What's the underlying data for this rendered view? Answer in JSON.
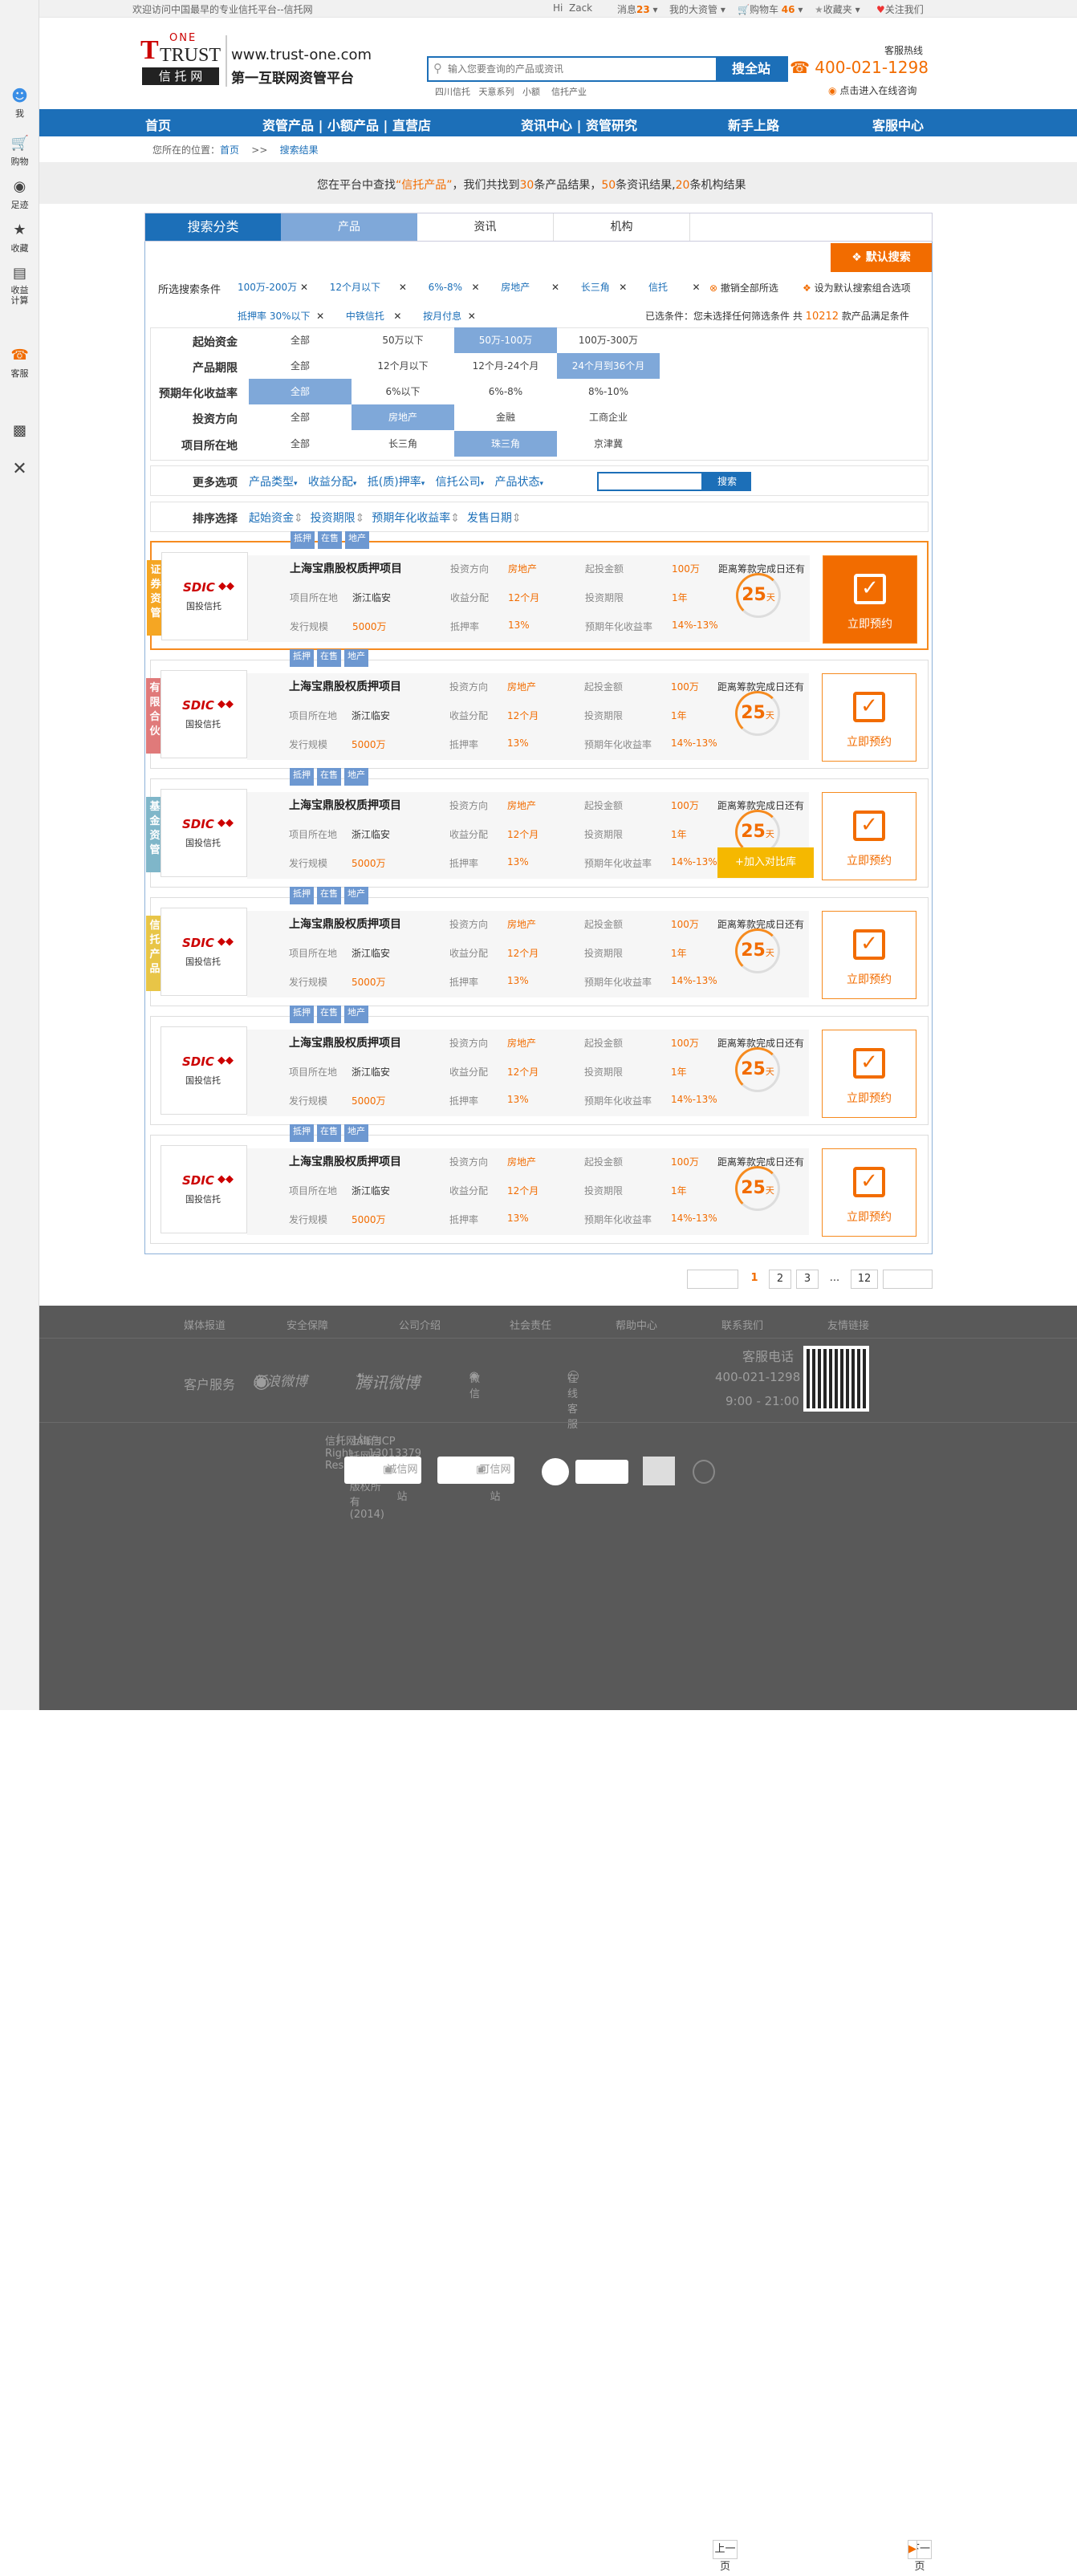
{
  "topbar": {
    "welcome": "欢迎访问中国最早的专业信托平台--信托网",
    "hi": "Hi",
    "user": "Zack",
    "messages": "消息",
    "messages_count": "23",
    "my_assets": "我的大资管",
    "cart": "购物车",
    "cart_count": "46",
    "favorites": "收藏夹",
    "follow": "关注我们"
  },
  "sidebar": {
    "items": [
      {
        "icon": "user-icon",
        "label": "我"
      },
      {
        "icon": "cart-icon",
        "label": "购物"
      },
      {
        "icon": "footprint-icon",
        "label": "足迹"
      },
      {
        "icon": "star-icon",
        "label": "收藏"
      },
      {
        "icon": "calculator-icon",
        "label": "收益计算"
      },
      {
        "icon": "service-icon",
        "label": "客服"
      },
      {
        "icon": "qrcode-icon",
        "label": ""
      },
      {
        "icon": "close-icon",
        "label": ""
      }
    ]
  },
  "header": {
    "logo_one": "ONE",
    "logo_trust": "TRUST",
    "logo_cn": "信 托 网",
    "domain": "www.trust-one.com",
    "slogan": "第一互联网资管平台",
    "search_placeholder": "输入您要查询的产品或资讯",
    "search_button": "搜全站",
    "hot_words": [
      "四川信托",
      "天意系列",
      "小额",
      "信托产业"
    ],
    "hotline_label": "客服热线",
    "hotline": "400-021-1298",
    "online": "点击进入在线咨询"
  },
  "nav": {
    "items": [
      "首页",
      "资管产品 | 小额产品 | 直营店",
      "资讯中心 | 资管研究",
      "新手上路",
      "客服中心"
    ]
  },
  "crumb": {
    "label": "您所在的位置：",
    "home": "首页",
    "sep": ">>",
    "current": "搜索结果"
  },
  "banner": {
    "prefix": "您在平台中查找",
    "keyword": "“信托产品”",
    "mid": "，我们共找到",
    "n1": "30",
    "t1": "条产品结果，",
    "n2": "50",
    "t2": "条资讯结果,",
    "n3": "20",
    "t3": "条机构结果"
  },
  "tabs": {
    "title": "搜索分类",
    "items": [
      "产品",
      "资讯",
      "机构"
    ]
  },
  "default_search": "默认搜索",
  "conditions": {
    "label": "所选搜索条件",
    "tags": [
      "100万-200万",
      "12个月以下",
      "6%-8%",
      "房地产",
      "长三角",
      "信托",
      "抵押率 30%以下",
      "中铁信托",
      "按月付息"
    ],
    "cancel_all": "撤销全部所选",
    "set_default": "设为默认搜索组合选项",
    "summary_prefix": "已选条件：",
    "summary_text": "您未选择任何筛选条件 共",
    "summary_count": "10212",
    "summary_suffix": "款产品满足条件"
  },
  "filters": [
    {
      "label": "起始资金",
      "options": [
        "全部",
        "50万以下",
        "50万-100万",
        "100万-300万"
      ],
      "selected": 2
    },
    {
      "label": "产品期限",
      "options": [
        "全部",
        "12个月以下",
        "12个月-24个月",
        "24个月到36个月"
      ],
      "selected": 3
    },
    {
      "label": "预期年化收益率",
      "options": [
        "全部",
        "6%以下",
        "6%-8%",
        "8%-10%"
      ],
      "selected": 0
    },
    {
      "label": "投资方向",
      "options": [
        "全部",
        "房地产",
        "金融",
        "工商企业"
      ],
      "selected": 1
    },
    {
      "label": "项目所在地",
      "options": [
        "全部",
        "长三角",
        "珠三角",
        "京津冀"
      ],
      "selected": 2
    }
  ],
  "more": {
    "label": "更多选项",
    "items": [
      "产品类型",
      "收益分配",
      "抵(质)押率",
      "信托公司",
      "产品状态"
    ],
    "search_button": "搜索"
  },
  "sort": {
    "label": "排序选择",
    "items": [
      "起始资金",
      "投资期限",
      "预期年化收益率",
      "发售日期"
    ]
  },
  "card_labels": {
    "direction": "投资方向",
    "min_amount": "起投金额",
    "countdown": "距离筹款完成日还有",
    "location": "项目所在地",
    "distribution": "收益分配",
    "period": "投资期限",
    "scale": "发行规模",
    "pledge": "抵押率",
    "yield": "预期年化收益率",
    "days_unit": "天",
    "book": "立即预约",
    "compare": "+加入对比库"
  },
  "products": [
    {
      "tag": "证券资管",
      "tag_color": "#f5a623",
      "ribbons": [
        "抵押",
        "在售",
        "地产"
      ],
      "company": "国投信托",
      "logo": "SDIC",
      "name": "上海宝鼎股权质押项目",
      "direction": "房地产",
      "min_amount": "100万",
      "location": "浙江临安",
      "distribution": "12个月",
      "period": "1年",
      "scale": "5000万",
      "pledge": "13%",
      "yield": "14%-13%",
      "days": "25"
    },
    {
      "tag": "有限合伙",
      "tag_color": "#e07a7a",
      "ribbons": [
        "抵押",
        "在售",
        "地产"
      ],
      "company": "国投信托",
      "logo": "SDIC",
      "name": "上海宝鼎股权质押项目",
      "direction": "房地产",
      "min_amount": "100万",
      "location": "浙江临安",
      "distribution": "12个月",
      "period": "1年",
      "scale": "5000万",
      "pledge": "13%",
      "yield": "14%-13%",
      "days": "25"
    },
    {
      "tag": "基金资管",
      "tag_color": "#7fb6c9",
      "ribbons": [
        "抵押",
        "在售",
        "地产"
      ],
      "company": "国投信托",
      "logo": "SDIC",
      "name": "上海宝鼎股权质押项目",
      "direction": "房地产",
      "min_amount": "100万",
      "location": "浙江临安",
      "distribution": "12个月",
      "period": "1年",
      "scale": "5000万",
      "pledge": "13%",
      "yield": "14%-13%",
      "days": "25"
    },
    {
      "tag": "信托产品",
      "tag_color": "#e8c547",
      "ribbons": [
        "抵押",
        "在售",
        "地产"
      ],
      "company": "国投信托",
      "logo": "SDIC",
      "name": "上海宝鼎股权质押项目",
      "direction": "房地产",
      "min_amount": "100万",
      "location": "浙江临安",
      "distribution": "12个月",
      "period": "1年",
      "scale": "5000万",
      "pledge": "13%",
      "yield": "14%-13%",
      "days": "25"
    },
    {
      "tag": "",
      "tag_color": "",
      "ribbons": [
        "抵押",
        "在售",
        "地产"
      ],
      "company": "国投信托",
      "logo": "SDIC",
      "name": "上海宝鼎股权质押项目",
      "direction": "房地产",
      "min_amount": "100万",
      "location": "浙江临安",
      "distribution": "12个月",
      "period": "1年",
      "scale": "5000万",
      "pledge": "13%",
      "yield": "14%-13%",
      "days": "25"
    },
    {
      "tag": "",
      "tag_color": "",
      "ribbons": [
        "抵押",
        "在售",
        "地产"
      ],
      "company": "国投信托",
      "logo": "SDIC",
      "name": "上海宝鼎股权质押项目",
      "direction": "房地产",
      "min_amount": "100万",
      "location": "浙江临安",
      "distribution": "12个月",
      "period": "1年",
      "scale": "5000万",
      "pledge": "13%",
      "yield": "14%-13%",
      "days": "25"
    }
  ],
  "pager": {
    "prev": "上一页",
    "pages": [
      "1",
      "2",
      "3",
      "...",
      "12"
    ],
    "current": "1",
    "next": "下一页"
  },
  "footer": {
    "links": [
      "媒体报道",
      "安全保障",
      "公司介绍",
      "社会责任",
      "帮助中心",
      "联系我们",
      "友情链接"
    ],
    "service": "客户服务",
    "weibo": "新浪微博",
    "tencent": "腾讯微博",
    "wechat": "微信",
    "online": "在线客服",
    "phone_label": "客服电话",
    "phone": "400-021-1298",
    "hours": "9:00 - 21:00",
    "copyright": "信托网All Right Reserved",
    "company": "上海信托网有限公司版权所有(2014)",
    "icp": "沪ICP 13013379号-3",
    "badges": [
      "诚信网站",
      "可信网站"
    ]
  }
}
